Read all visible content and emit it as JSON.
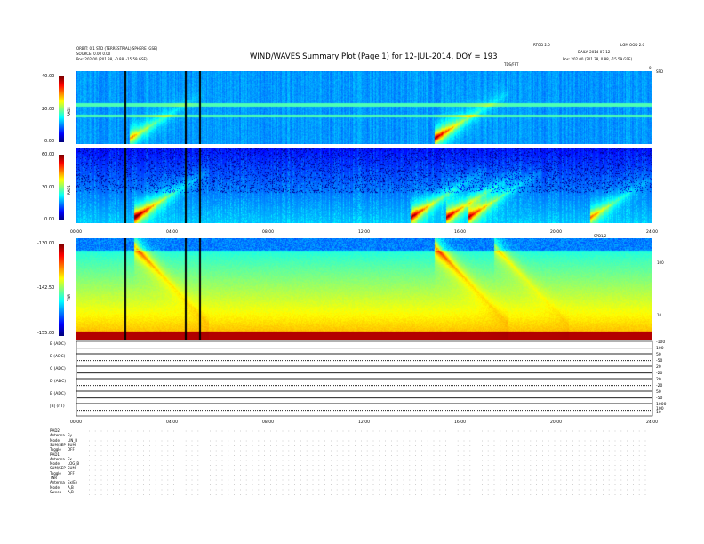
{
  "header": {
    "title": "WIND/WAVES Summary Plot (Page 1) for 12-JUL-2014, DOY = 193",
    "left_line1": "ORBIT: 0.1 STD (TERRESTRIAL) SPHERE (GSE)",
    "left_line2": "SOURCE: 0.00 0.00",
    "left_pos": "Pos:     202.00 (201.38, -0.88, -15.59 GSE)",
    "right_pos": "Pos:     202.00 (201.38, 0.88, -15.59 GSE)",
    "center_small": "RTOD 2.0",
    "right_small1": "LGM OOD 2.0",
    "right_small2": "DAILY: 2014-07-12",
    "mid_marker": "TDS/FFT",
    "right_marker": "SPD",
    "top_right": "0"
  },
  "chart_data": [
    {
      "type": "heatmap",
      "name": "RAD2",
      "ylabel": "RAD2",
      "colorbar_ticks": [
        "40.00",
        "20.00",
        "0.00"
      ],
      "events": [
        {
          "t": 15.0,
          "strength": 0.95
        },
        {
          "t": 2.3,
          "strength": 0.6
        }
      ]
    },
    {
      "type": "heatmap",
      "name": "RAD1",
      "ylabel": "RAD1",
      "colorbar_ticks": [
        "60.00",
        "30.00",
        "0.00"
      ],
      "x_ticks": [
        "00:00",
        "04:00",
        "08:00",
        "12:00",
        "16:00",
        "20:00",
        "24:00"
      ],
      "events": [
        {
          "t": 2.5,
          "strength": 1.0
        },
        {
          "t": 14.0,
          "strength": 0.9
        },
        {
          "t": 15.5,
          "strength": 0.85
        },
        {
          "t": 16.4,
          "strength": 0.8
        },
        {
          "t": 21.5,
          "strength": 0.6
        }
      ]
    },
    {
      "type": "heatmap",
      "name": "TNR",
      "ylabel": "TNR",
      "colorbar_ticks": [
        "-130.00",
        "-142.50",
        "-155.00"
      ],
      "right_ticks": [
        "100",
        "10"
      ],
      "top_right_label": "SPD1/2",
      "events": [
        {
          "t": 2.5,
          "strength": 0.9
        },
        {
          "t": 15.0,
          "strength": 1.0
        },
        {
          "t": 17.5,
          "strength": 0.6
        }
      ]
    },
    {
      "type": "line",
      "name": "summary strips",
      "rows": [
        {
          "label": "B (ADC)",
          "ticks": [
            "-100",
            "100"
          ]
        },
        {
          "label": "E (ADC)",
          "ticks": [
            "50",
            "-50"
          ]
        },
        {
          "label": "C (ADC)",
          "ticks": [
            "20",
            "-20"
          ]
        },
        {
          "label": "D (ADC)",
          "ticks": [
            "20",
            "-20"
          ]
        },
        {
          "label": "B (ADC)",
          "ticks": [
            "50",
            "-50"
          ]
        },
        {
          "label": "|B| (nT)",
          "ticks": [
            "1000",
            "100",
            "10"
          ]
        }
      ],
      "x_ticks": [
        "00:00",
        "04:00",
        "08:00",
        "12:00",
        "16:00",
        "20:00",
        "24:00"
      ]
    }
  ],
  "settings": {
    "rad2": [
      {
        "k": "RAD2",
        "v": ""
      },
      {
        "k": "Antenna",
        "v": "Ey"
      },
      {
        "k": "Mode",
        "v": "LIN_B"
      },
      {
        "k": "SUM/SEP",
        "v": "SUM"
      },
      {
        "k": "Toggle",
        "v": "OFF"
      }
    ],
    "rad1": [
      {
        "k": "RAD1",
        "v": ""
      },
      {
        "k": "Antenna",
        "v": "Ex"
      },
      {
        "k": "Mode",
        "v": "LOG_B"
      },
      {
        "k": "SUM/SEP",
        "v": "SUM"
      },
      {
        "k": "Toggle",
        "v": "OFF"
      }
    ],
    "tnr": [
      {
        "k": "TNR",
        "v": ""
      },
      {
        "k": "Antenna",
        "v": "Ex/Ey"
      },
      {
        "k": "Mode",
        "v": "A,B"
      },
      {
        "k": "Sweep",
        "v": "A,B"
      }
    ]
  }
}
